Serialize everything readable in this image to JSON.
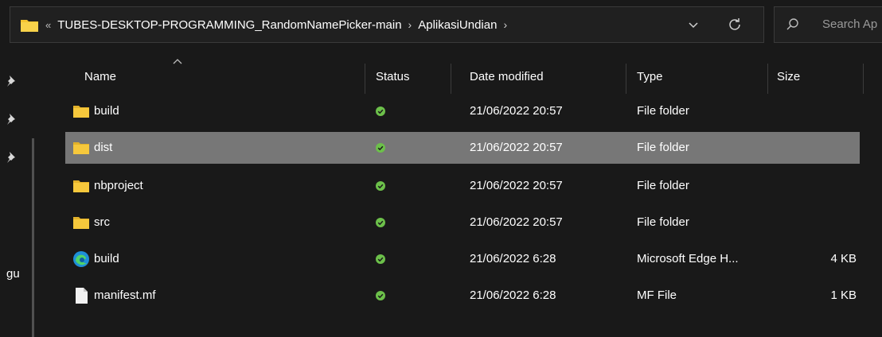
{
  "address": {
    "overflow_marker": "«",
    "crumbs": [
      "TUBES-DESKTOP-PROGRAMMING_RandomNamePicker-main",
      "AplikasiUndian"
    ]
  },
  "search": {
    "placeholder": "Search Ap"
  },
  "nav": {
    "partial_label": "gu"
  },
  "columns": {
    "name": "Name",
    "status": "Status",
    "date": "Date modified",
    "type": "Type",
    "size": "Size"
  },
  "files": [
    {
      "name": "build",
      "icon": "folder-icon",
      "status": "synced",
      "date": "21/06/2022 20:57",
      "type": "File folder",
      "size": "",
      "selected": false
    },
    {
      "name": "dist",
      "icon": "folder-icon",
      "status": "synced",
      "date": "21/06/2022 20:57",
      "type": "File folder",
      "size": "",
      "selected": true
    },
    {
      "name": "nbproject",
      "icon": "folder-icon",
      "status": "synced",
      "date": "21/06/2022 20:57",
      "type": "File folder",
      "size": "",
      "selected": false
    },
    {
      "name": "src",
      "icon": "folder-icon",
      "status": "synced",
      "date": "21/06/2022 20:57",
      "type": "File folder",
      "size": "",
      "selected": false
    },
    {
      "name": "build",
      "icon": "edge-icon",
      "status": "synced",
      "date": "21/06/2022 6:28",
      "type": "Microsoft Edge H...",
      "size": "4 KB",
      "selected": false
    },
    {
      "name": "manifest.mf",
      "icon": "file-icon",
      "status": "synced",
      "date": "21/06/2022 6:28",
      "type": "MF File",
      "size": "1 KB",
      "selected": false
    }
  ],
  "colors": {
    "background": "#191919",
    "selection": "#777777",
    "folder": "#f4c430",
    "status_green": "#6cc04a"
  }
}
